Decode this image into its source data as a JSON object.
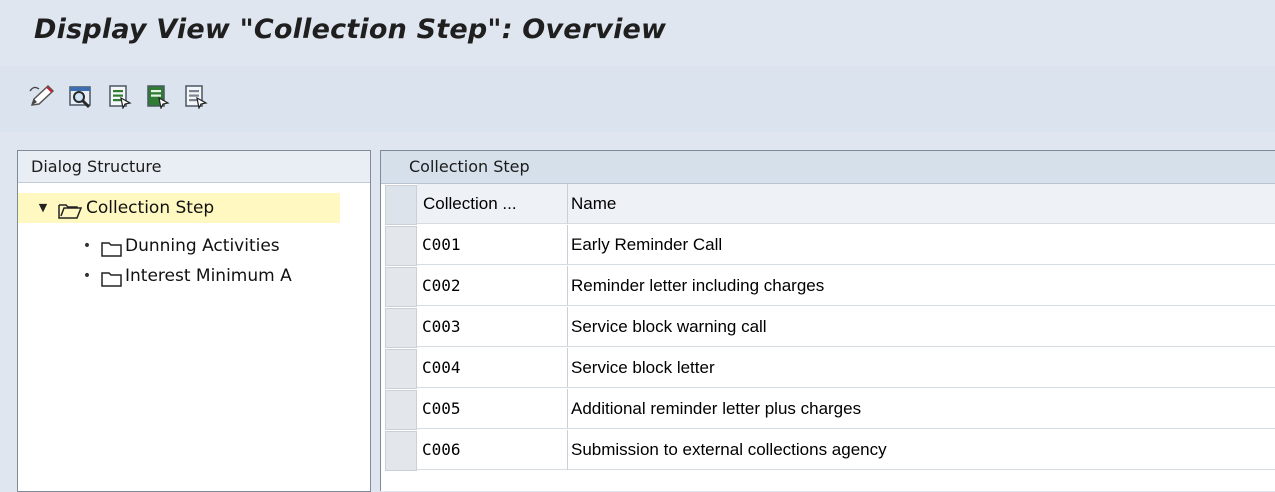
{
  "window": {
    "title": "Display View \"Collection Step\": Overview"
  },
  "toolbar": {
    "icons": [
      "change-display-icon",
      "details-icon",
      "select-all-icon",
      "select-block-icon",
      "deselect-all-icon"
    ]
  },
  "dialog_structure": {
    "header": "Dialog Structure",
    "items": [
      {
        "label": "Collection Step",
        "level": 0,
        "expanded": true,
        "selected": true
      },
      {
        "label": "Dunning Activities",
        "level": 1
      },
      {
        "label": "Interest Minimum A",
        "level": 1
      }
    ]
  },
  "table": {
    "title": "Collection Step",
    "columns": [
      "Collection ...",
      "Name"
    ],
    "rows": [
      {
        "step": "C001",
        "name": "Early Reminder Call"
      },
      {
        "step": "C002",
        "name": "Reminder letter including charges"
      },
      {
        "step": "C003",
        "name": "Service block warning call"
      },
      {
        "step": "C004",
        "name": "Service block letter"
      },
      {
        "step": "C005",
        "name": "Additional reminder letter plus charges"
      },
      {
        "step": "C006",
        "name": "Submission to external collections agency"
      }
    ]
  },
  "colors": {
    "background": "#dfe6ef",
    "selected_node": "#fff9c1",
    "panel_header": "#d5e0eb"
  }
}
